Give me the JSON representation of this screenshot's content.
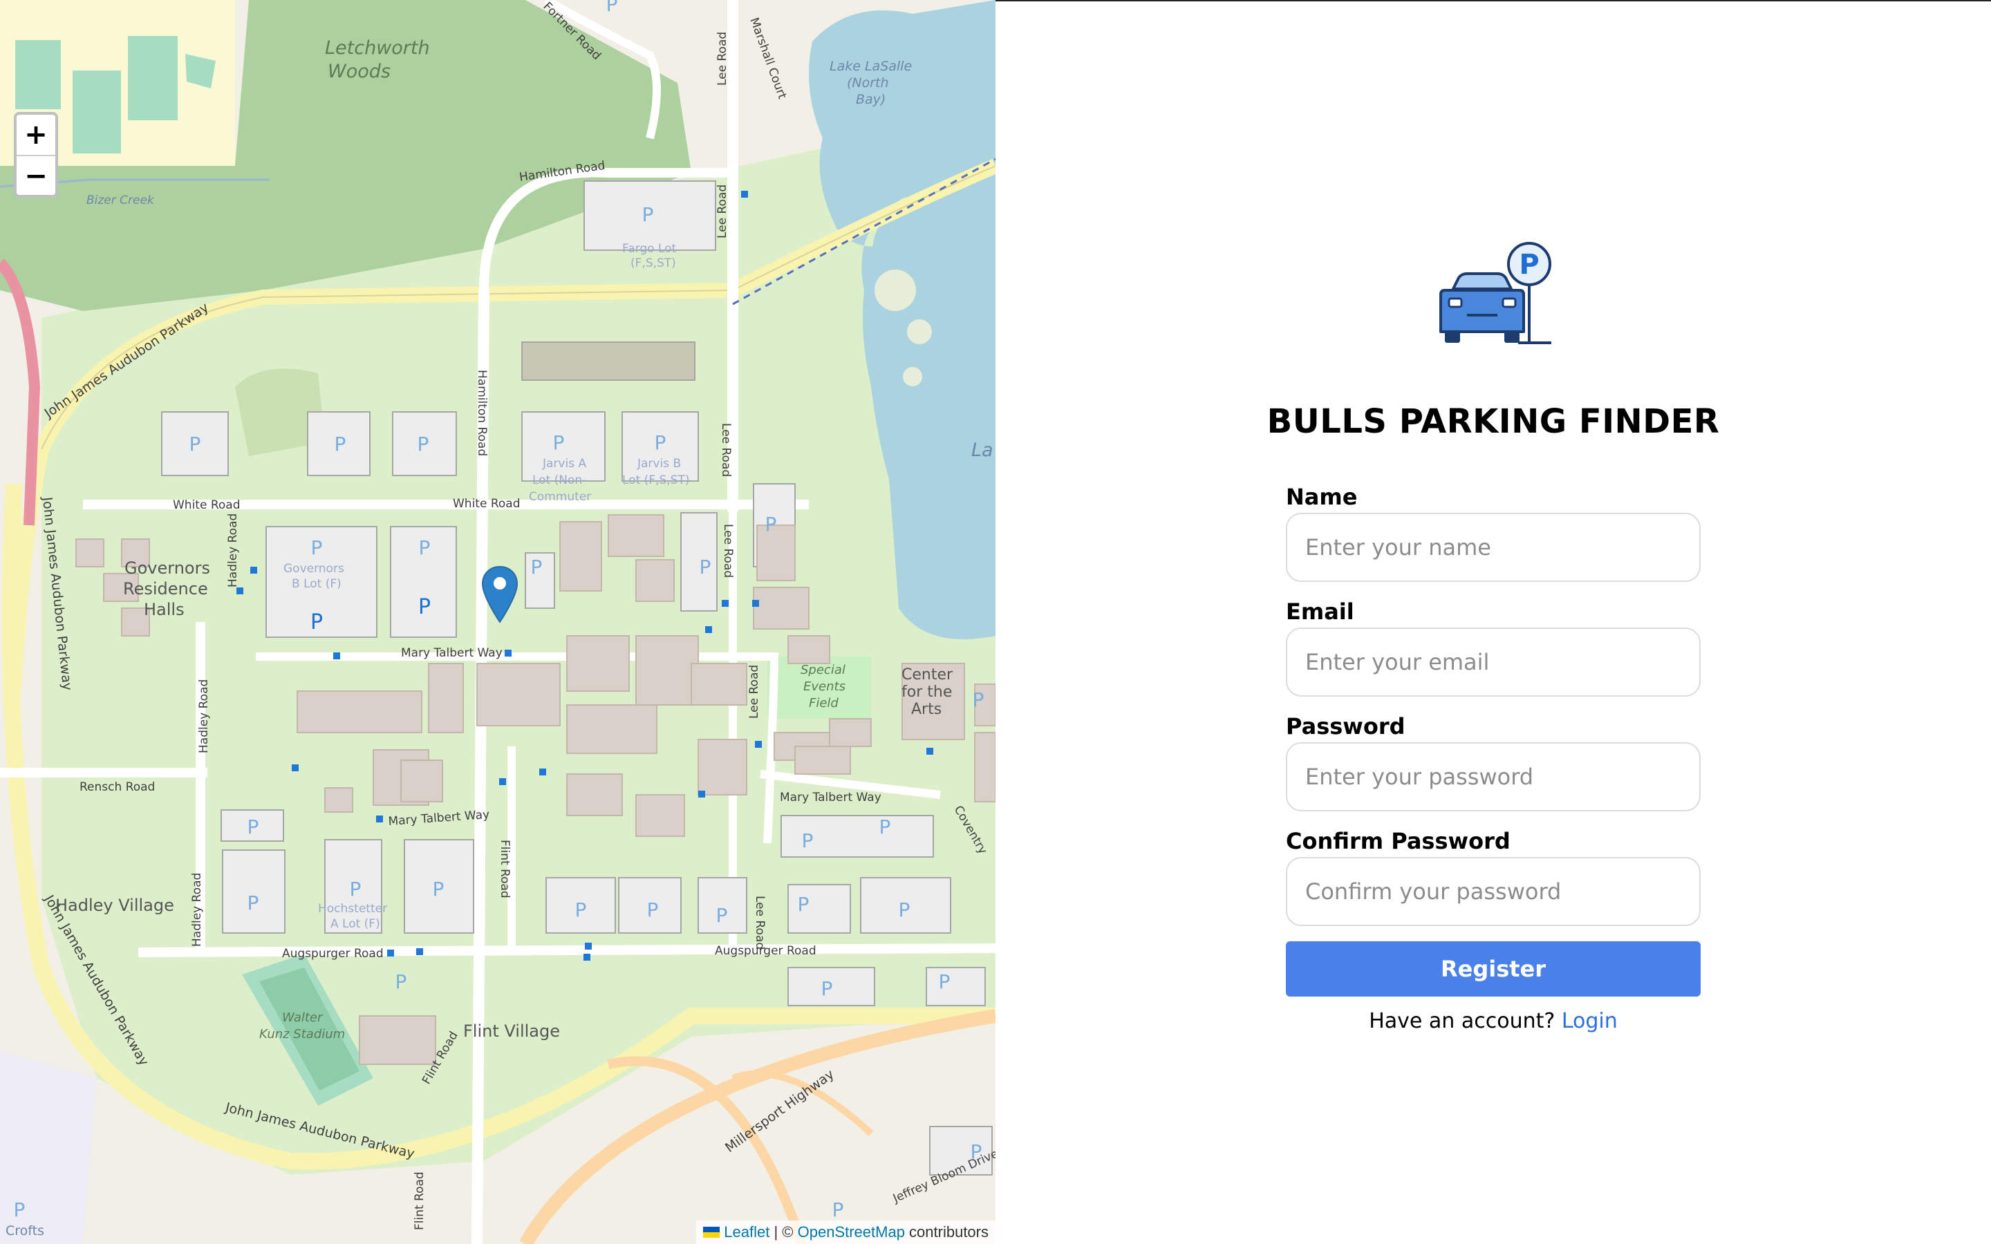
{
  "map": {
    "zoom_in_label": "+",
    "zoom_out_label": "−",
    "attribution": {
      "leaflet": "Leaflet",
      "separator": " | © ",
      "osm": "OpenStreetMap",
      "suffix": " contributors"
    },
    "labels": {
      "letchworth_1": "Letchworth",
      "letchworth_2": "Woods",
      "bizer_creek": "Bizer Creek",
      "hamilton_road_top": "Hamilton Road",
      "hamilton_road_vertical": "Hamilton Road",
      "lee_road_1": "Lee Road",
      "lee_road_2": "Lee Road",
      "lee_road_3": "Lee Road",
      "lee_road_4": "Lee Road",
      "lee_road_5": "Lee Road",
      "lee_road_6": "Lee Road",
      "marshall_court": "Marshall Court",
      "fortner_road": "Fortner Road",
      "lake_lasalle_1": "Lake LaSalle",
      "lake_lasalle_2": "(North",
      "lake_lasalle_3": "Bay)",
      "lake_partial": "La",
      "fargo_lot_1": "Fargo Lot",
      "fargo_lot_2": "(F,S,ST)",
      "audubon_1": "John James Audubon Parkway",
      "audubon_2": "John James Audubon Parkway",
      "audubon_3": "John James Audubon Parkway",
      "audubon_4": "John James Audubon Parkway",
      "white_road_1": "White Road",
      "white_road_2": "White Road",
      "hadley_road_1": "Hadley Road",
      "hadley_road_2": "Hadley Road",
      "hadley_road_3": "Hadley Road",
      "governors_1": "Governors",
      "governors_2": "Residence",
      "governors_3": "Halls",
      "governors_lot_1": "Governors",
      "governors_lot_2": "B Lot (F)",
      "jarvis_a_1": "Jarvis A",
      "jarvis_a_2": "Lot (Non-",
      "jarvis_a_3": "Commuter",
      "jarvis_b_1": "Jarvis B",
      "jarvis_b_2": "Lot (F,S,ST)",
      "mary_talbert_1": "Mary Talbert Way",
      "mary_talbert_2": "Mary Talbert Way",
      "mary_talbert_3": "Mary Talbert Way",
      "special_1": "Special",
      "special_2": "Events",
      "special_3": "Field",
      "center_1": "Center",
      "center_2": "for the",
      "center_3": "Arts",
      "rensch_road": "Rensch Road",
      "flint_road_1": "Flint Road",
      "flint_road_2": "Flint Road",
      "flint_road_3": "Flint Road",
      "hochstetter_1": "Hochstetter",
      "hochstetter_2": "A Lot (F)",
      "augspurger_1": "Augspurger Road",
      "augspurger_2": "Augspurger Road",
      "hadley_village": "Hadley Village",
      "walter_1": "Walter",
      "walter_2": "Kunz Stadium",
      "flint_village": "Flint Village",
      "millersport": "Millersport Highway",
      "jeffrey_bloom": "Jeffrey Bloom Drive",
      "coventry": "Coventry",
      "crofts": "Crofts",
      "parking": "P"
    }
  },
  "app": {
    "title": "BULLS PARKING FINDER"
  },
  "form": {
    "name_label": "Name",
    "name_placeholder": "Enter your name",
    "email_label": "Email",
    "email_placeholder": "Enter your email",
    "password_label": "Password",
    "password_placeholder": "Enter your password",
    "confirm_label": "Confirm Password",
    "confirm_placeholder": "Confirm your password",
    "register_label": "Register",
    "have_account": "Have an account? ",
    "login_label": "Login"
  }
}
